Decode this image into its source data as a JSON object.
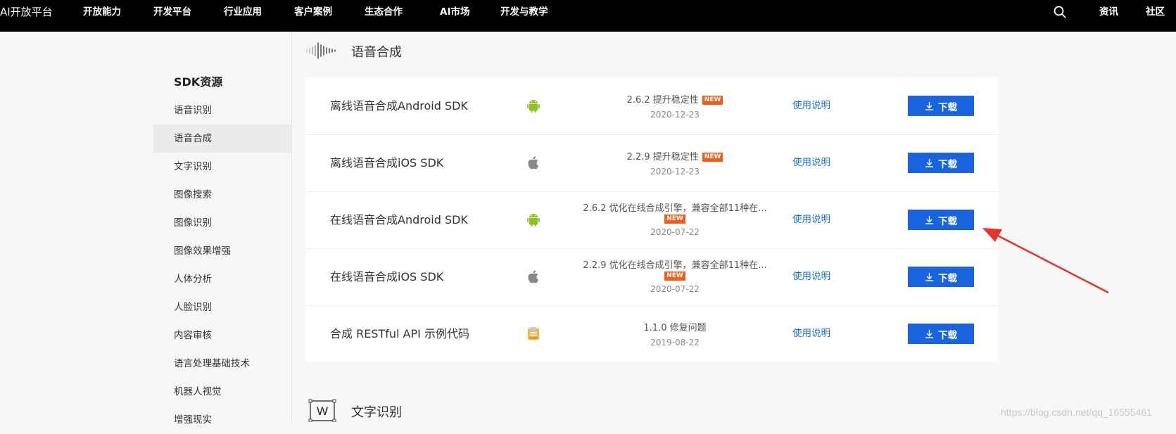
{
  "topnav": {
    "logo": "AI开放平台",
    "items": [
      "开放能力",
      "开发平台",
      "行业应用",
      "客户案例",
      "生态合作",
      "AI市场",
      "开发与教学"
    ],
    "right_items": [
      "资讯",
      "社区"
    ],
    "search_icon": "search-icon"
  },
  "sidebar": {
    "title": "SDK资源",
    "items": [
      "语音识别",
      "语音合成",
      "文字识别",
      "图像搜索",
      "图像识别",
      "图像效果增强",
      "人体分析",
      "人脸识别",
      "内容审核",
      "语言处理基础技术",
      "机器人视觉",
      "增强现实"
    ],
    "active_index": 1
  },
  "section": {
    "title": "语音合成",
    "icon": "waveform-icon"
  },
  "rows": [
    {
      "name": "离线语音合成Android SDK",
      "platform": "android-icon",
      "version": "2.6.2 提升稳定性",
      "new": "NEW",
      "date": "2020-12-23",
      "doc": "使用说明",
      "download": "下载"
    },
    {
      "name": "离线语音合成iOS SDK",
      "platform": "apple-icon",
      "version": "2.2.9 提升稳定性",
      "new": "NEW",
      "date": "2020-12-23",
      "doc": "使用说明",
      "download": "下载"
    },
    {
      "name": "在线语音合成Android SDK",
      "platform": "android-icon",
      "version": "2.6.2 优化在线合成引擎，兼容全部11种在...",
      "new": "NEW",
      "date": "2020-07-22",
      "doc": "使用说明",
      "download": "下载"
    },
    {
      "name": "在线语音合成iOS SDK",
      "platform": "apple-icon",
      "version": "2.2.9 优化在线合成引擎，兼容全部11种在...",
      "new": "NEW",
      "date": "2020-07-22",
      "doc": "使用说明",
      "download": "下载"
    },
    {
      "name": "合成 RESTful API 示例代码",
      "platform": "folder-code-icon",
      "version": "1.1.0 修复问题",
      "new": "",
      "date": "2019-08-22",
      "doc": "使用说明",
      "download": "下载"
    }
  ],
  "next_section": {
    "title": "文字识别",
    "icon_letter": "W"
  },
  "watermark": "https://blog.csdn.net/qq_16555461",
  "colors": {
    "accent": "#1764de",
    "link": "#1e74d6",
    "badge": "#f25f1c",
    "android": "#8dc21f",
    "arrow": "#e8322c"
  }
}
